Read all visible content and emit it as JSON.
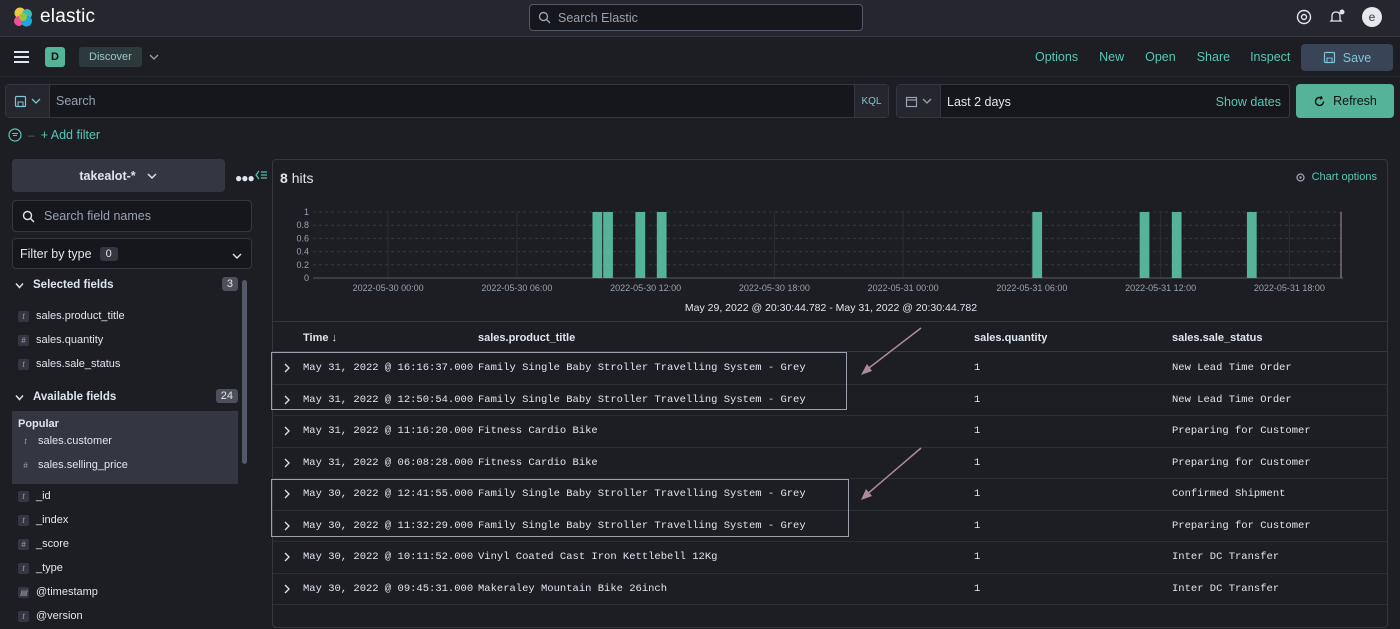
{
  "app": {
    "logo_text": "elastic",
    "search_placeholder": "Search Elastic",
    "avatar_letter": "e"
  },
  "nav": {
    "space": "D",
    "breadcrumb": "Discover",
    "menu": [
      "Options",
      "New",
      "Open",
      "Share",
      "Inspect"
    ],
    "save_label": "Save"
  },
  "query": {
    "placeholder": "Search",
    "language": "KQL"
  },
  "date": {
    "range": "Last 2 days",
    "show_dates": "Show dates",
    "refresh": "Refresh"
  },
  "filters": {
    "add_filter": "+ Add filter"
  },
  "sidebar": {
    "index_pattern": "takealot-*",
    "field_search_placeholder": "Search field names",
    "filter_by_type": "Filter by type",
    "filter_count": "0",
    "selected_title": "Selected fields",
    "selected_count": "3",
    "selected_fields": [
      {
        "type": "t",
        "name": "sales.product_title"
      },
      {
        "type": "#",
        "name": "sales.quantity"
      },
      {
        "type": "t",
        "name": "sales.sale_status"
      }
    ],
    "available_title": "Available fields",
    "available_count": "24",
    "popular_label": "Popular",
    "popular_fields": [
      {
        "type": "t",
        "name": "sales.customer"
      },
      {
        "type": "#",
        "name": "sales.selling_price"
      }
    ],
    "other_fields": [
      {
        "type": "t",
        "name": "_id"
      },
      {
        "type": "t",
        "name": "_index"
      },
      {
        "type": "#",
        "name": "_score"
      },
      {
        "type": "t",
        "name": "_type"
      },
      {
        "type": "cal",
        "name": "@timestamp"
      },
      {
        "type": "t",
        "name": "@version"
      }
    ]
  },
  "results": {
    "hits_count": "8",
    "hits_label": "hits",
    "chart_options": "Chart options",
    "range_label": "May 29, 2022 @ 20:30:44.782 - May 31, 2022 @ 20:30:44.782",
    "columns": [
      "Time",
      "sales.product_title",
      "sales.quantity",
      "sales.sale_status"
    ],
    "rows": [
      {
        "time": "May 31, 2022 @ 16:16:37.000",
        "title": "Family Single Baby Stroller Travelling System - Grey",
        "qty": "1",
        "status": "New Lead Time Order"
      },
      {
        "time": "May 31, 2022 @ 12:50:54.000",
        "title": "Family Single Baby Stroller Travelling System - Grey",
        "qty": "1",
        "status": "New Lead Time Order"
      },
      {
        "time": "May 31, 2022 @ 11:16:20.000",
        "title": "Fitness Cardio Bike",
        "qty": "1",
        "status": "Preparing for Customer"
      },
      {
        "time": "May 31, 2022 @ 06:08:28.000",
        "title": "Fitness Cardio Bike",
        "qty": "1",
        "status": "Preparing for Customer"
      },
      {
        "time": "May 30, 2022 @ 12:41:55.000",
        "title": "Family Single Baby Stroller Travelling System - Grey",
        "qty": "1",
        "status": "Confirmed Shipment"
      },
      {
        "time": "May 30, 2022 @ 11:32:29.000",
        "title": "Family Single Baby Stroller Travelling System - Grey",
        "qty": "1",
        "status": "Preparing for Customer"
      },
      {
        "time": "May 30, 2022 @ 10:11:52.000",
        "title": "Vinyl Coated Cast Iron Kettlebell 12Kg",
        "qty": "1",
        "status": "Inter DC Transfer"
      },
      {
        "time": "May 30, 2022 @ 09:45:31.000",
        "title": "Makeraley Mountain Bike 26inch",
        "qty": "1",
        "status": "Inter DC Transfer"
      }
    ]
  },
  "chart_data": {
    "type": "bar",
    "x_ticks": [
      "2022-05-30 00:00",
      "2022-05-30 06:00",
      "2022-05-30 12:00",
      "2022-05-30 18:00",
      "2022-05-31 00:00",
      "2022-05-31 06:00",
      "2022-05-31 12:00",
      "2022-05-31 18:00"
    ],
    "y_ticks": [
      "0",
      "0.2",
      "0.4",
      "0.6",
      "0.8",
      "1"
    ],
    "ylim": [
      0,
      1
    ],
    "x_start_hours_after_2022_05_30": -3.5,
    "x_end_hours_after_2022_05_30": 44.5,
    "bars": [
      {
        "time": "2022-05-30 09:30",
        "value": 1
      },
      {
        "time": "2022-05-30 10:00",
        "value": 1
      },
      {
        "time": "2022-05-30 11:30",
        "value": 1
      },
      {
        "time": "2022-05-30 12:30",
        "value": 1
      },
      {
        "time": "2022-05-31 06:00",
        "value": 1
      },
      {
        "time": "2022-05-31 11:00",
        "value": 1
      },
      {
        "time": "2022-05-31 12:30",
        "value": 1
      },
      {
        "time": "2022-05-31 16:00",
        "value": 1
      }
    ],
    "bar_color": "#54b399"
  },
  "colors": {
    "accent": "#54b399",
    "link": "#58c6b4",
    "bg": "#1d1e24"
  }
}
